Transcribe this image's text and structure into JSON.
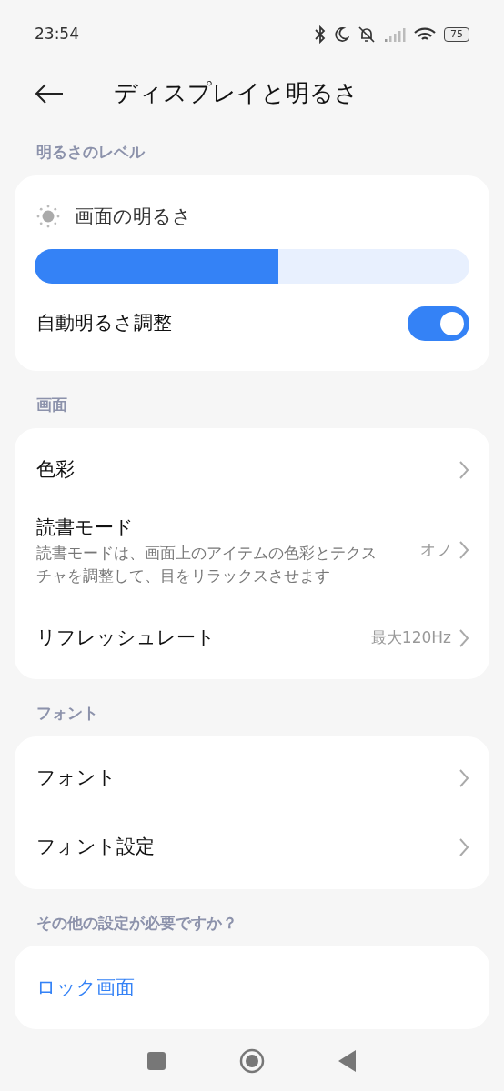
{
  "status_bar": {
    "time": "23:54",
    "battery": "75"
  },
  "header": {
    "title": "ディスプレイと明るさ"
  },
  "sections": [
    {
      "label": "明るさのレベル",
      "items": [
        {
          "kind": "slider",
          "label": "画面の明るさ",
          "level": 0.56
        },
        {
          "kind": "toggle",
          "label": "自動明るさ調整",
          "on": true
        }
      ]
    },
    {
      "label": "画面",
      "items": [
        {
          "kind": "link",
          "label": "色彩"
        },
        {
          "kind": "link",
          "label": "読書モード",
          "description": "読書モードは、画面上のアイテムの色彩とテクスチャを調整して、目をリラックスさせます",
          "value": "オフ"
        },
        {
          "kind": "link",
          "label": "リフレッシュレート",
          "value": "最大120Hz"
        }
      ]
    },
    {
      "label": "フォント",
      "items": [
        {
          "kind": "link",
          "label": "フォント"
        },
        {
          "kind": "link",
          "label": "フォント設定"
        }
      ]
    },
    {
      "label": "その他の設定が必要ですか？",
      "items": [
        {
          "kind": "shortcut",
          "label": "ロック画面"
        }
      ]
    }
  ]
}
